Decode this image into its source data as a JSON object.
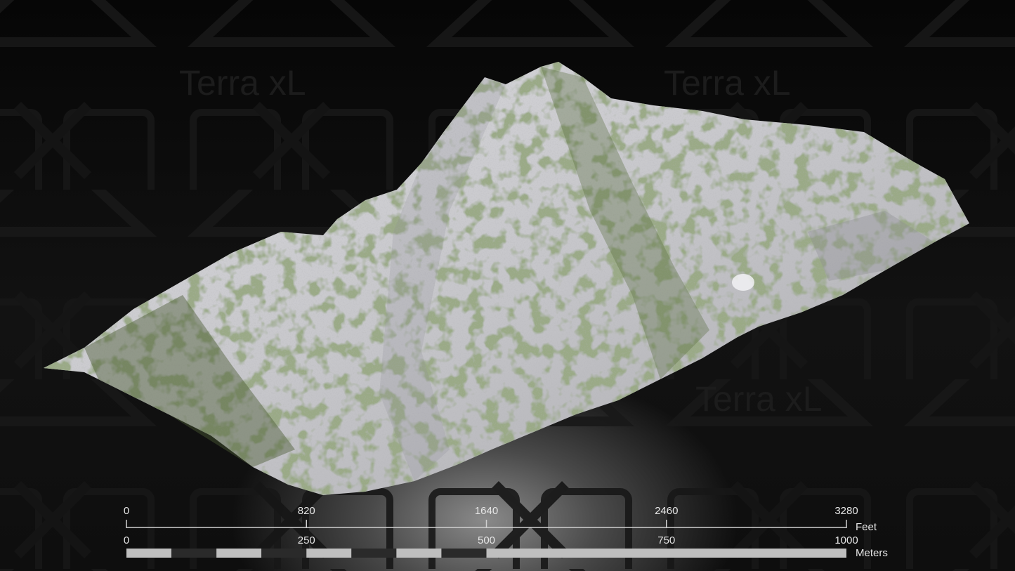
{
  "watermark": {
    "text": "Terra xL"
  },
  "map": {
    "subject": "3D terrain mesh of a mountain",
    "colors": {
      "rock": "#c9c9cc",
      "rock_shadow": "#9a9a9e",
      "vegetation": "#4f5e3a",
      "vegetation_light": "#7a8a3e",
      "background": "#0b0b0b"
    }
  },
  "scale": {
    "feet": {
      "unit": "Feet",
      "ticks": [
        "0",
        "820",
        "1640",
        "2460",
        "3280"
      ],
      "max": 3280
    },
    "meters": {
      "unit": "Meters",
      "ticks": [
        "0",
        "250",
        "500",
        "750",
        "1000"
      ],
      "max": 1000,
      "segments": [
        {
          "from": 0,
          "to": 62.5,
          "color": "#bfbfbf"
        },
        {
          "from": 62.5,
          "to": 125,
          "color": "#2a2a2a"
        },
        {
          "from": 125,
          "to": 187.5,
          "color": "#bfbfbf"
        },
        {
          "from": 187.5,
          "to": 250,
          "color": "#2a2a2a"
        },
        {
          "from": 250,
          "to": 312.5,
          "color": "#bfbfbf"
        },
        {
          "from": 312.5,
          "to": 375,
          "color": "#2a2a2a"
        },
        {
          "from": 375,
          "to": 437.5,
          "color": "#bfbfbf"
        },
        {
          "from": 437.5,
          "to": 500,
          "color": "#2a2a2a"
        },
        {
          "from": 500,
          "to": 1000,
          "color": "#bfbfbf"
        }
      ]
    }
  }
}
